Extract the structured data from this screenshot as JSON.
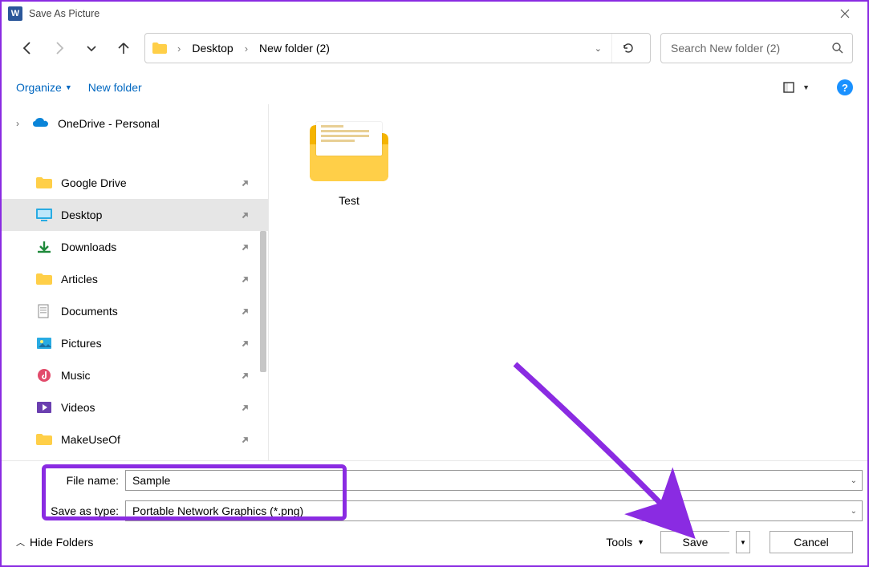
{
  "window": {
    "title": "Save As Picture"
  },
  "breadcrumb": {
    "items": [
      "Desktop",
      "New folder (2)"
    ]
  },
  "search": {
    "placeholder": "Search New folder (2)"
  },
  "toolbar": {
    "organize_label": "Organize",
    "newfolder_label": "New folder"
  },
  "tree": {
    "onedrive_label": "OneDrive - Personal",
    "items": [
      {
        "label": "Google Drive",
        "icon": "folder",
        "pinned": true
      },
      {
        "label": "Desktop",
        "icon": "desktop",
        "pinned": true,
        "selected": true
      },
      {
        "label": "Downloads",
        "icon": "downloads",
        "pinned": true
      },
      {
        "label": "Articles",
        "icon": "folder",
        "pinned": true
      },
      {
        "label": "Documents",
        "icon": "documents",
        "pinned": true
      },
      {
        "label": "Pictures",
        "icon": "pictures",
        "pinned": true
      },
      {
        "label": "Music",
        "icon": "music",
        "pinned": true
      },
      {
        "label": "Videos",
        "icon": "videos",
        "pinned": true
      },
      {
        "label": "MakeUseOf",
        "icon": "folder",
        "pinned": true
      }
    ]
  },
  "content": {
    "items": [
      {
        "label": "Test",
        "type": "folder"
      }
    ]
  },
  "fields": {
    "filename_label": "File name:",
    "filename_value": "Sample",
    "savetype_label": "Save as type:",
    "savetype_value": "Portable Network Graphics (*.png)"
  },
  "footer": {
    "hidefolders_label": "Hide Folders",
    "tools_label": "Tools",
    "save_label": "Save",
    "cancel_label": "Cancel"
  }
}
